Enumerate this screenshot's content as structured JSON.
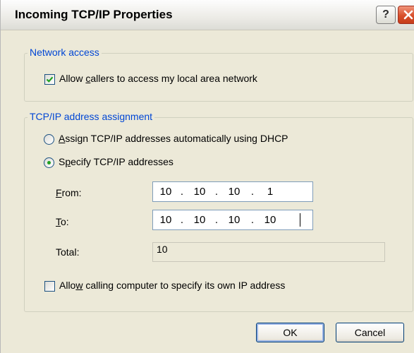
{
  "window": {
    "title": "Incoming TCP/IP Properties",
    "help_label": "?"
  },
  "network_access": {
    "legend": "Network access",
    "allow_lan": {
      "label_pre": "Allow ",
      "label_ul": "c",
      "label_post": "allers to access my local area network",
      "checked": true
    }
  },
  "address_assignment": {
    "legend": "TCP/IP address assignment",
    "dhcp_option": {
      "label_ul": "A",
      "label_post": "ssign TCP/IP addresses automatically using DHCP",
      "selected": false
    },
    "specify_option": {
      "label_pre": "S",
      "label_ul": "p",
      "label_post": "ecify TCP/IP addresses",
      "selected": true
    },
    "from": {
      "label_ul": "F",
      "label_post": "rom:",
      "octets": [
        "10",
        "10",
        "10",
        "1"
      ]
    },
    "to": {
      "label_ul": "T",
      "label_post": "o:",
      "octets": [
        "10",
        "10",
        "10",
        "10"
      ]
    },
    "total": {
      "label": "Total:",
      "value": "10"
    },
    "allow_own_ip": {
      "label_pre": "Allo",
      "label_ul": "w",
      "label_post": " calling computer to specify its own IP address",
      "checked": false
    }
  },
  "buttons": {
    "ok": "OK",
    "cancel": "Cancel"
  },
  "colors": {
    "accent": "#0046d5",
    "dialog_bg": "#ece9d8",
    "check_green": "#21a121"
  },
  "ip_separator": "."
}
